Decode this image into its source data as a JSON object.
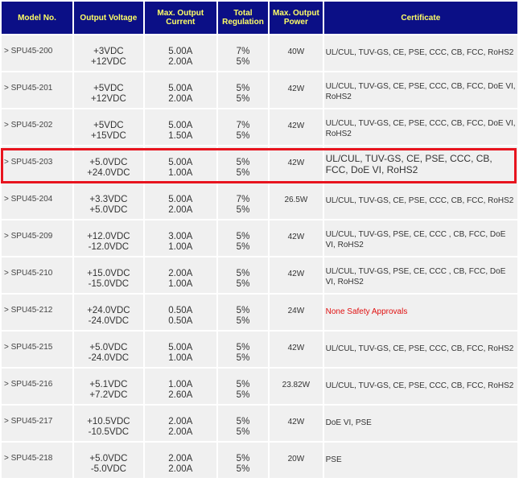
{
  "headers": {
    "model": "Model No.",
    "voltage": "Output Voltage",
    "current": "Max. Output Current",
    "regulation": "Total Regulation",
    "power": "Max. Output Power",
    "certificate": "Certificate"
  },
  "rows": [
    {
      "model": "> SPU45-200",
      "v1": "+3VDC",
      "v2": "+12VDC",
      "c1": "5.00A",
      "c2": "2.00A",
      "r1": "7%",
      "r2": "5%",
      "power": "40W",
      "cert": "UL/CUL, TUV-GS, CE, PSE, CCC, CB, FCC, RoHS2"
    },
    {
      "model": "> SPU45-201",
      "v1": "+5VDC",
      "v2": "+12VDC",
      "c1": "5.00A",
      "c2": "2.00A",
      "r1": "5%",
      "r2": "5%",
      "power": "42W",
      "cert": "UL/CUL, TUV-GS, CE, PSE, CCC, CB, FCC, DoE VI, RoHS2"
    },
    {
      "model": "> SPU45-202",
      "v1": "+5VDC",
      "v2": "+15VDC",
      "c1": "5.00A",
      "c2": "1.50A",
      "r1": "7%",
      "r2": "5%",
      "power": "42W",
      "cert": "UL/CUL, TUV-GS, CE, PSE, CCC, CB, FCC, DoE VI, RoHS2"
    },
    {
      "model": "> SPU45-203",
      "v1": "+5.0VDC",
      "v2": "+24.0VDC",
      "c1": "5.00A",
      "c2": "1.00A",
      "r1": "5%",
      "r2": "5%",
      "power": "42W",
      "cert": "UL/CUL, TUV-GS, CE, PSE, CCC, CB, FCC, DoE VI,  RoHS2"
    },
    {
      "model": "> SPU45-204",
      "v1": "+3.3VDC",
      "v2": "+5.0VDC",
      "c1": "5.00A",
      "c2": "2.00A",
      "r1": "7%",
      "r2": "5%",
      "power": "26.5W",
      "cert": "UL/CUL, TUV-GS, CE, PSE, CCC, CB, FCC, RoHS2"
    },
    {
      "model": "> SPU45-209",
      "v1": "+12.0VDC",
      "v2": "-12.0VDC",
      "c1": "3.00A",
      "c2": "1.00A",
      "r1": "5%",
      "r2": "5%",
      "power": "42W",
      "cert": "UL/CUL, TUV-GS, PSE, CE, CCC , CB, FCC, DoE VI, RoHS2"
    },
    {
      "model": "> SPU45-210",
      "v1": "+15.0VDC",
      "v2": "-15.0VDC",
      "c1": "2.00A",
      "c2": "1.00A",
      "r1": "5%",
      "r2": "5%",
      "power": "42W",
      "cert": "UL/CUL, TUV-GS, PSE, CE, CCC , CB, FCC, DoE VI, RoHS2"
    },
    {
      "model": "> SPU45-212",
      "v1": "+24.0VDC",
      "v2": "-24.0VDC",
      "c1": "0.50A",
      "c2": "0.50A",
      "r1": "5%",
      "r2": "5%",
      "power": "24W",
      "cert": "None Safety Approvals"
    },
    {
      "model": "> SPU45-215",
      "v1": "+5.0VDC",
      "v2": "-24.0VDC",
      "c1": "5.00A",
      "c2": "1.00A",
      "r1": "5%",
      "r2": "5%",
      "power": "42W",
      "cert": "UL/CUL, TUV-GS, CE, PSE, CCC, CB, FCC, RoHS2"
    },
    {
      "model": "> SPU45-216",
      "v1": "+5.1VDC",
      "v2": "+7.2VDC",
      "c1": "1.00A",
      "c2": "2.60A",
      "r1": "5%",
      "r2": "5%",
      "power": "23.82W",
      "cert": "UL/CUL, TUV-GS, CE, PSE, CCC, CB, FCC, RoHS2"
    },
    {
      "model": "> SPU45-217",
      "v1": "+10.5VDC",
      "v2": "-10.5VDC",
      "c1": "2.00A",
      "c2": "2.00A",
      "r1": "5%",
      "r2": "5%",
      "power": "42W",
      "cert": "DoE VI, PSE"
    },
    {
      "model": "> SPU45-218",
      "v1": "+5.0VDC",
      "v2": "-5.0VDC",
      "c1": "2.00A",
      "c2": "2.00A",
      "r1": "5%",
      "r2": "5%",
      "power": "20W",
      "cert": "PSE"
    }
  ],
  "colors": {
    "header_bg": "#0b0f86",
    "header_text": "#ffff66",
    "cell_bg": "#f0f0f0",
    "highlight": "#e8141e",
    "warning_text": "#e01010"
  }
}
